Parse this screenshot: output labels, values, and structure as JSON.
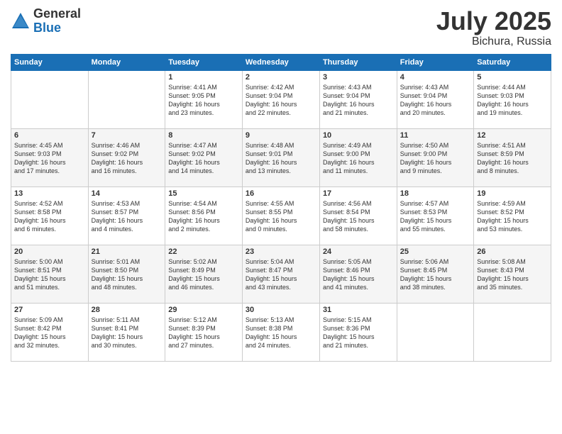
{
  "header": {
    "logo_general": "General",
    "logo_blue": "Blue",
    "month_title": "July 2025",
    "location": "Bichura, Russia"
  },
  "weekdays": [
    "Sunday",
    "Monday",
    "Tuesday",
    "Wednesday",
    "Thursday",
    "Friday",
    "Saturday"
  ],
  "weeks": [
    [
      {
        "day": "",
        "info": ""
      },
      {
        "day": "",
        "info": ""
      },
      {
        "day": "1",
        "info": "Sunrise: 4:41 AM\nSunset: 9:05 PM\nDaylight: 16 hours\nand 23 minutes."
      },
      {
        "day": "2",
        "info": "Sunrise: 4:42 AM\nSunset: 9:04 PM\nDaylight: 16 hours\nand 22 minutes."
      },
      {
        "day": "3",
        "info": "Sunrise: 4:43 AM\nSunset: 9:04 PM\nDaylight: 16 hours\nand 21 minutes."
      },
      {
        "day": "4",
        "info": "Sunrise: 4:43 AM\nSunset: 9:04 PM\nDaylight: 16 hours\nand 20 minutes."
      },
      {
        "day": "5",
        "info": "Sunrise: 4:44 AM\nSunset: 9:03 PM\nDaylight: 16 hours\nand 19 minutes."
      }
    ],
    [
      {
        "day": "6",
        "info": "Sunrise: 4:45 AM\nSunset: 9:03 PM\nDaylight: 16 hours\nand 17 minutes."
      },
      {
        "day": "7",
        "info": "Sunrise: 4:46 AM\nSunset: 9:02 PM\nDaylight: 16 hours\nand 16 minutes."
      },
      {
        "day": "8",
        "info": "Sunrise: 4:47 AM\nSunset: 9:02 PM\nDaylight: 16 hours\nand 14 minutes."
      },
      {
        "day": "9",
        "info": "Sunrise: 4:48 AM\nSunset: 9:01 PM\nDaylight: 16 hours\nand 13 minutes."
      },
      {
        "day": "10",
        "info": "Sunrise: 4:49 AM\nSunset: 9:00 PM\nDaylight: 16 hours\nand 11 minutes."
      },
      {
        "day": "11",
        "info": "Sunrise: 4:50 AM\nSunset: 9:00 PM\nDaylight: 16 hours\nand 9 minutes."
      },
      {
        "day": "12",
        "info": "Sunrise: 4:51 AM\nSunset: 8:59 PM\nDaylight: 16 hours\nand 8 minutes."
      }
    ],
    [
      {
        "day": "13",
        "info": "Sunrise: 4:52 AM\nSunset: 8:58 PM\nDaylight: 16 hours\nand 6 minutes."
      },
      {
        "day": "14",
        "info": "Sunrise: 4:53 AM\nSunset: 8:57 PM\nDaylight: 16 hours\nand 4 minutes."
      },
      {
        "day": "15",
        "info": "Sunrise: 4:54 AM\nSunset: 8:56 PM\nDaylight: 16 hours\nand 2 minutes."
      },
      {
        "day": "16",
        "info": "Sunrise: 4:55 AM\nSunset: 8:55 PM\nDaylight: 16 hours\nand 0 minutes."
      },
      {
        "day": "17",
        "info": "Sunrise: 4:56 AM\nSunset: 8:54 PM\nDaylight: 15 hours\nand 58 minutes."
      },
      {
        "day": "18",
        "info": "Sunrise: 4:57 AM\nSunset: 8:53 PM\nDaylight: 15 hours\nand 55 minutes."
      },
      {
        "day": "19",
        "info": "Sunrise: 4:59 AM\nSunset: 8:52 PM\nDaylight: 15 hours\nand 53 minutes."
      }
    ],
    [
      {
        "day": "20",
        "info": "Sunrise: 5:00 AM\nSunset: 8:51 PM\nDaylight: 15 hours\nand 51 minutes."
      },
      {
        "day": "21",
        "info": "Sunrise: 5:01 AM\nSunset: 8:50 PM\nDaylight: 15 hours\nand 48 minutes."
      },
      {
        "day": "22",
        "info": "Sunrise: 5:02 AM\nSunset: 8:49 PM\nDaylight: 15 hours\nand 46 minutes."
      },
      {
        "day": "23",
        "info": "Sunrise: 5:04 AM\nSunset: 8:47 PM\nDaylight: 15 hours\nand 43 minutes."
      },
      {
        "day": "24",
        "info": "Sunrise: 5:05 AM\nSunset: 8:46 PM\nDaylight: 15 hours\nand 41 minutes."
      },
      {
        "day": "25",
        "info": "Sunrise: 5:06 AM\nSunset: 8:45 PM\nDaylight: 15 hours\nand 38 minutes."
      },
      {
        "day": "26",
        "info": "Sunrise: 5:08 AM\nSunset: 8:43 PM\nDaylight: 15 hours\nand 35 minutes."
      }
    ],
    [
      {
        "day": "27",
        "info": "Sunrise: 5:09 AM\nSunset: 8:42 PM\nDaylight: 15 hours\nand 32 minutes."
      },
      {
        "day": "28",
        "info": "Sunrise: 5:11 AM\nSunset: 8:41 PM\nDaylight: 15 hours\nand 30 minutes."
      },
      {
        "day": "29",
        "info": "Sunrise: 5:12 AM\nSunset: 8:39 PM\nDaylight: 15 hours\nand 27 minutes."
      },
      {
        "day": "30",
        "info": "Sunrise: 5:13 AM\nSunset: 8:38 PM\nDaylight: 15 hours\nand 24 minutes."
      },
      {
        "day": "31",
        "info": "Sunrise: 5:15 AM\nSunset: 8:36 PM\nDaylight: 15 hours\nand 21 minutes."
      },
      {
        "day": "",
        "info": ""
      },
      {
        "day": "",
        "info": ""
      }
    ]
  ]
}
